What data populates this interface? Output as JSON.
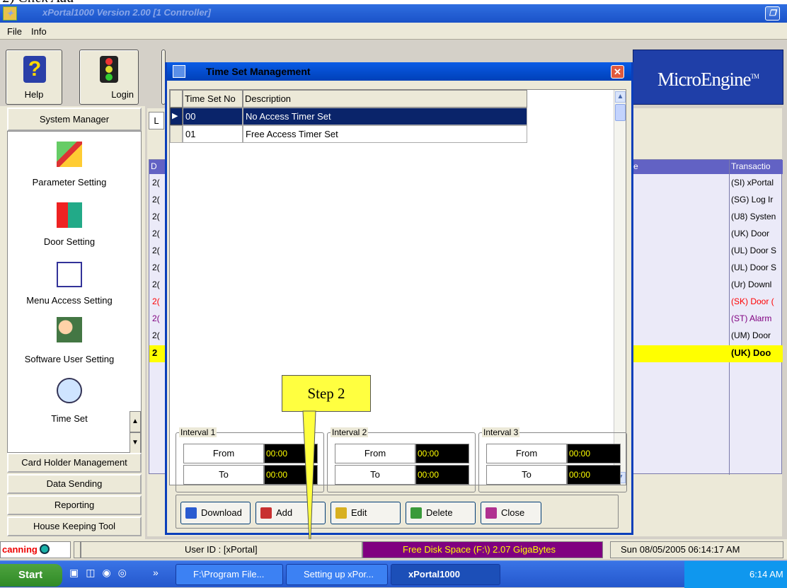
{
  "window": {
    "title": "xPortal1000 Version 2.00 [1 Controller]",
    "heading_fragment": "2)   Click Add"
  },
  "menu": {
    "items": [
      "File",
      "Info"
    ]
  },
  "toolbar": {
    "help": "Help",
    "login": "Login",
    "logo": "MicroEngine",
    "logo_tm": "TM"
  },
  "sidebar": {
    "system_manager": "System Manager",
    "items": [
      {
        "label": "Parameter Setting",
        "icon": "parameter-icon"
      },
      {
        "label": "Door Setting",
        "icon": "door-icon"
      },
      {
        "label": "Menu Access Setting",
        "icon": "menu-access-icon"
      },
      {
        "label": "Software User Setting",
        "icon": "users-icon"
      },
      {
        "label": "Time Set",
        "icon": "clock-icon"
      }
    ],
    "nav": [
      "Card Holder Management",
      "Data Sending",
      "Reporting",
      "House Keeping Tool"
    ]
  },
  "background": {
    "tab_letter": "L",
    "col_d": "D",
    "col_e": "e",
    "col_transaction": "Transactio",
    "rows": [
      {
        "d": "2(",
        "t": "(SI) xPortal",
        "color": "#000000"
      },
      {
        "d": "2(",
        "t": "(SG) Log Ir",
        "color": "#000000"
      },
      {
        "d": "2(",
        "t": "(U8) Systen",
        "color": "#000000"
      },
      {
        "d": "2(",
        "t": "(UK) Door",
        "color": "#000000"
      },
      {
        "d": "2(",
        "t": "(UL) Door S",
        "color": "#000000"
      },
      {
        "d": "2(",
        "t": "(UL) Door S",
        "color": "#000000"
      },
      {
        "d": "2(",
        "t": "(Ur) Downl",
        "color": "#000000"
      },
      {
        "d": "2(",
        "t": "(SK) Door (",
        "color": "#ff0000"
      },
      {
        "d": "2(",
        "t": "(ST) Alarm",
        "color": "#800080"
      },
      {
        "d": "2(",
        "t": "(UM) Door",
        "color": "#000000"
      },
      {
        "d": "2",
        "t": "(UK) Doo",
        "color": "#000000",
        "highlight": true
      }
    ]
  },
  "dialog": {
    "title": "Time Set Management",
    "columns": [
      "Time Set No",
      "Description"
    ],
    "rows": [
      {
        "no": "00",
        "desc": "No Access Timer Set",
        "selected": true
      },
      {
        "no": "01",
        "desc": "Free Access Timer Set",
        "selected": false
      }
    ],
    "intervals": [
      {
        "label": "Interval 1",
        "from_label": "From",
        "to_label": "To",
        "from": "00:00",
        "to": "00:00"
      },
      {
        "label": "Interval 2",
        "from_label": "From",
        "to_label": "To",
        "from": "00:00",
        "to": "00:00"
      },
      {
        "label": "Interval 3",
        "from_label": "From",
        "to_label": "To",
        "from": "00:00",
        "to": "00:00"
      }
    ],
    "buttons": {
      "download": "Download",
      "add": "Add",
      "edit": "Edit",
      "delete": "Delete",
      "close": "Close"
    }
  },
  "callout": "Step 2",
  "status": {
    "left": "canning",
    "user": "User ID : [xPortal]",
    "disk": "Free Disk Space (F:\\) 2.07   GigaBytes",
    "datetime": "Sun 08/05/2005 06:14:17 AM"
  },
  "taskbar": {
    "start": "Start",
    "more": "»",
    "tasks": [
      "F:\\Program File...",
      "Setting up xPor...",
      "xPortal1000"
    ],
    "clock": "6:14 AM"
  },
  "colors": {
    "dialog_title": "#0a5ce6",
    "selected_row": "#0a246a",
    "highlight": "#ffff00",
    "callout": "#ffff40"
  }
}
